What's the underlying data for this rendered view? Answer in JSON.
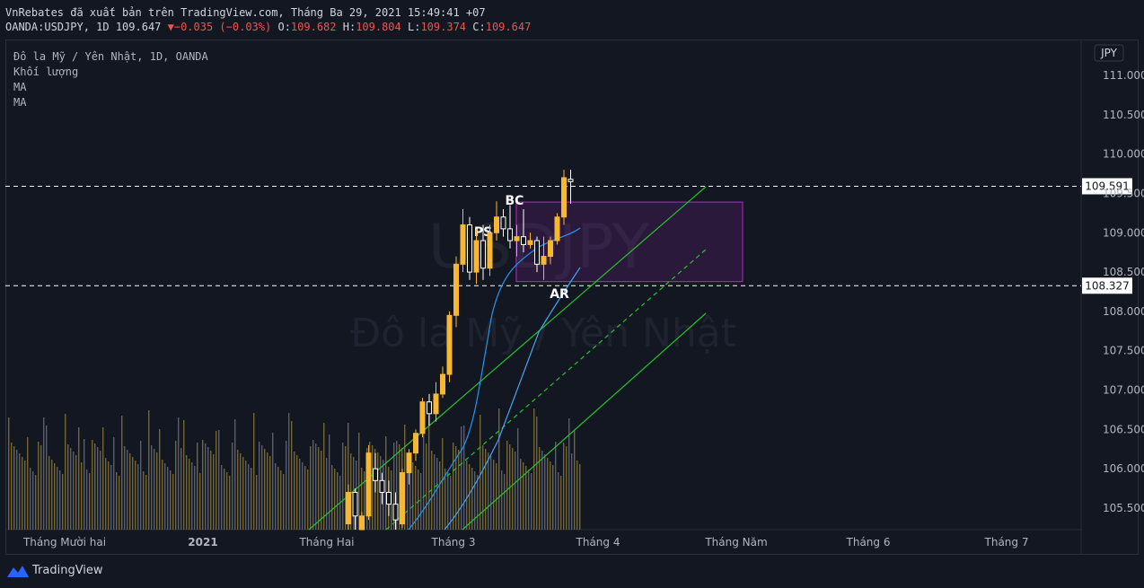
{
  "header": {
    "publish_line": "VnRebates đã xuất bản trên TradingView.com, Tháng Ba 29, 2021 15:49:41 +07",
    "symbol_prefix": "OANDA:USDJPY, 1D 109.647",
    "change": "−0.035 (−0.03%)",
    "o_label": "O:",
    "o_value": "109.682",
    "h_label": "H:",
    "h_value": "109.804",
    "l_label": "L:",
    "l_value": "109.374",
    "c_label": "C:",
    "c_value": "109.647"
  },
  "legend": {
    "title": "Đô la Mỹ / Yên Nhật, 1D, OANDA",
    "volume": "Khối lượng",
    "ma1": "MA",
    "ma2": "MA"
  },
  "watermark": {
    "symbol": "USDJPY",
    "name": "Đô la Mỹ / Yên Nhật"
  },
  "footer": {
    "brand": "TradingView"
  },
  "colors": {
    "background": "#131722",
    "up": "#f7b733",
    "down": "#ffffff",
    "channel": "#26c42a",
    "range_box": "#9c27b0",
    "ma_fast": "#2196f3",
    "ma_slow": "#42a5f5"
  },
  "chart_data": {
    "type": "candlestick",
    "currency": "JPY",
    "y_ticks": [
      "111.000",
      "110.500",
      "110.000",
      "109.500",
      "109.000",
      "108.500",
      "108.000",
      "107.500",
      "107.000",
      "106.500",
      "106.000",
      "105.500"
    ],
    "ylim": [
      105.3,
      111.3
    ],
    "x_ticks": [
      "Tháng Mười hai",
      "2021",
      "Tháng Hai",
      "Tháng 3",
      "Tháng 4",
      "Tháng Năm",
      "Tháng 6",
      "Tháng 7"
    ],
    "price_labels": [
      "109.591",
      "108.327"
    ],
    "horizontal_lines": [
      109.591,
      108.327
    ],
    "annotations": [
      "PS",
      "BC",
      "AR"
    ],
    "range_box": {
      "top": 109.39,
      "bottom": 108.38
    },
    "candles": [
      {
        "o": 105.3,
        "h": 105.8,
        "l": 105.2,
        "c": 105.7
      },
      {
        "o": 105.7,
        "h": 105.75,
        "l": 105.2,
        "c": 105.4
      },
      {
        "o": 105.2,
        "h": 105.45,
        "l": 105.0,
        "c": 105.4
      },
      {
        "o": 105.4,
        "h": 106.3,
        "l": 105.35,
        "c": 106.2
      },
      {
        "o": 106.0,
        "h": 106.2,
        "l": 105.7,
        "c": 105.85
      },
      {
        "o": 105.85,
        "h": 105.95,
        "l": 105.55,
        "c": 105.7
      },
      {
        "o": 105.7,
        "h": 105.85,
        "l": 105.4,
        "c": 105.55
      },
      {
        "o": 105.55,
        "h": 105.7,
        "l": 105.2,
        "c": 105.35
      },
      {
        "o": 105.3,
        "h": 106.0,
        "l": 105.25,
        "c": 105.95
      },
      {
        "o": 105.95,
        "h": 106.25,
        "l": 105.8,
        "c": 106.2
      },
      {
        "o": 106.2,
        "h": 106.5,
        "l": 106.1,
        "c": 106.45
      },
      {
        "o": 106.45,
        "h": 106.9,
        "l": 106.4,
        "c": 106.85
      },
      {
        "o": 106.85,
        "h": 106.95,
        "l": 106.55,
        "c": 106.7
      },
      {
        "o": 106.7,
        "h": 107.1,
        "l": 106.6,
        "c": 106.95
      },
      {
        "o": 106.95,
        "h": 107.3,
        "l": 106.9,
        "c": 107.2
      },
      {
        "o": 107.2,
        "h": 108.0,
        "l": 107.1,
        "c": 107.95
      },
      {
        "o": 107.95,
        "h": 108.7,
        "l": 107.8,
        "c": 108.6
      },
      {
        "o": 108.6,
        "h": 109.3,
        "l": 108.5,
        "c": 109.1
      },
      {
        "o": 109.1,
        "h": 109.2,
        "l": 108.4,
        "c": 108.5
      },
      {
        "o": 108.5,
        "h": 109.05,
        "l": 108.35,
        "c": 108.9
      },
      {
        "o": 108.9,
        "h": 109.1,
        "l": 108.4,
        "c": 108.55
      },
      {
        "o": 108.55,
        "h": 109.1,
        "l": 108.45,
        "c": 109.0
      },
      {
        "o": 109.0,
        "h": 109.4,
        "l": 108.9,
        "c": 109.2
      },
      {
        "o": 109.2,
        "h": 109.3,
        "l": 108.95,
        "c": 109.05
      },
      {
        "o": 109.05,
        "h": 109.35,
        "l": 108.8,
        "c": 108.9
      },
      {
        "o": 108.9,
        "h": 109.1,
        "l": 108.7,
        "c": 108.95
      },
      {
        "o": 108.95,
        "h": 109.3,
        "l": 108.75,
        "c": 108.85
      },
      {
        "o": 108.85,
        "h": 109.0,
        "l": 108.8,
        "c": 108.9
      },
      {
        "o": 108.9,
        "h": 108.95,
        "l": 108.5,
        "c": 108.6
      },
      {
        "o": 108.6,
        "h": 108.95,
        "l": 108.4,
        "c": 108.7
      },
      {
        "o": 108.7,
        "h": 108.95,
        "l": 108.6,
        "c": 108.9
      },
      {
        "o": 108.9,
        "h": 109.25,
        "l": 108.85,
        "c": 109.2
      },
      {
        "o": 109.2,
        "h": 109.8,
        "l": 109.1,
        "c": 109.7
      },
      {
        "o": 109.68,
        "h": 109.8,
        "l": 109.37,
        "c": 109.65
      }
    ]
  }
}
